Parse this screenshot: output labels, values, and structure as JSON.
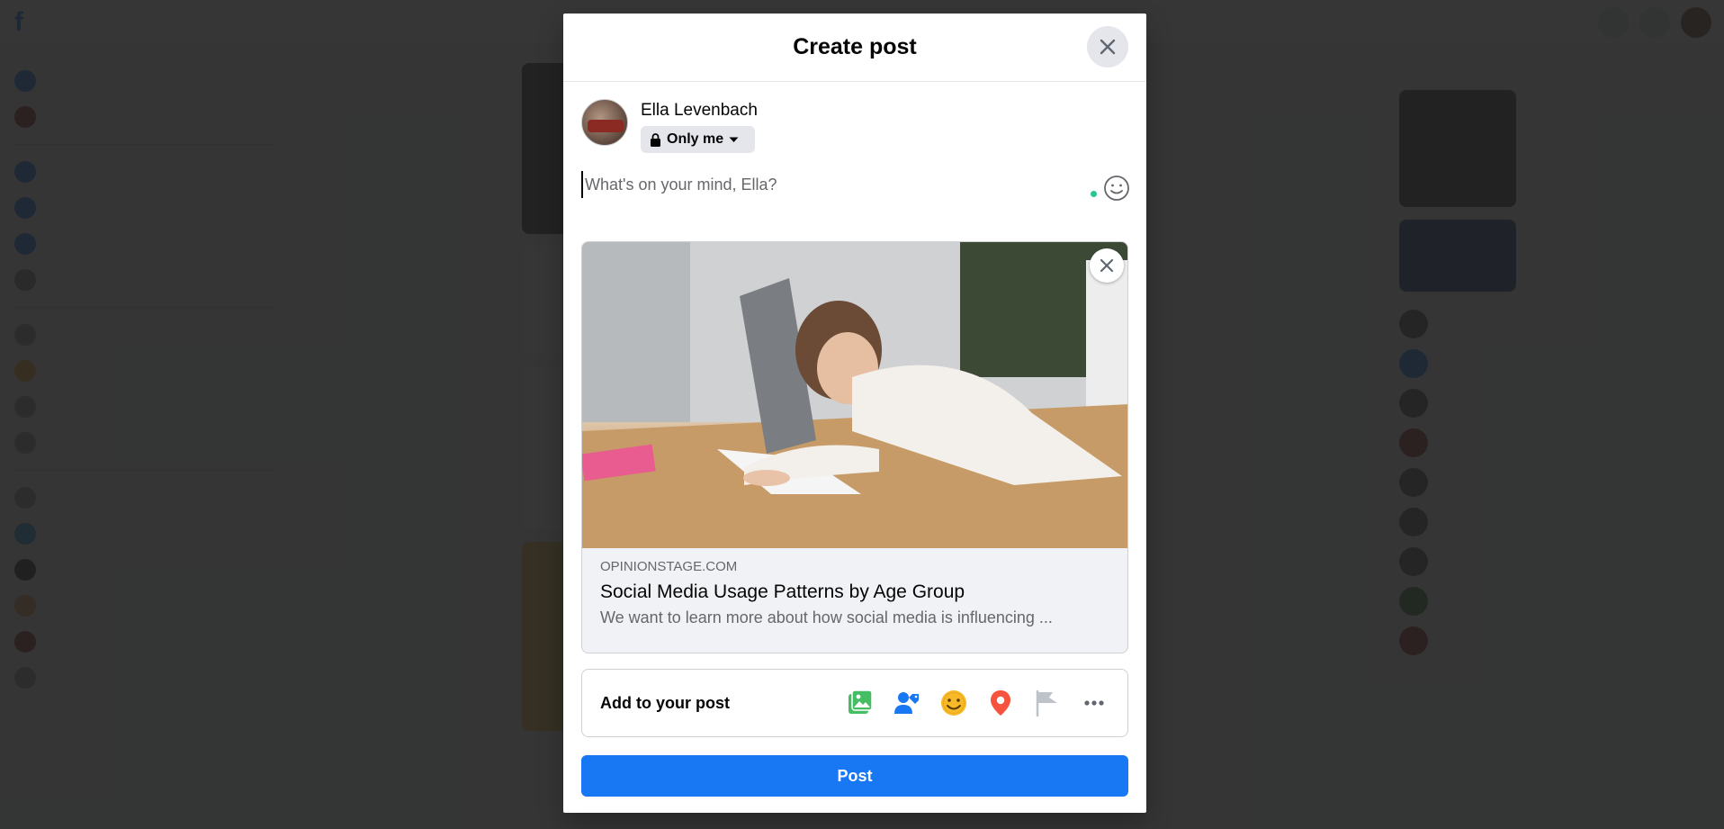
{
  "modal": {
    "title": "Create post",
    "author_name": "Ella Levenbach",
    "audience_label": "Only me",
    "composer_placeholder": "What's on your mind, Ella?",
    "link_preview": {
      "domain": "OPINIONSTAGE.COM",
      "title": "Social Media Usage Patterns by Age Group",
      "description": "We want to learn more about how social media is influencing ..."
    },
    "add_to_post_label": "Add to your post",
    "add_to_post_icons": [
      "photo-video-icon",
      "tag-people-icon",
      "feeling-icon",
      "check-in-icon",
      "life-event-flag-icon",
      "more-icon"
    ],
    "post_button_label": "Post"
  },
  "colors": {
    "accent": "#1877f2",
    "overlay": "#202020",
    "photo_green": "#45bd62",
    "tag_blue": "#1877f2",
    "feeling_yellow": "#f7b928",
    "checkin_red": "#f5533d",
    "flag_gray": "#bec3c9"
  }
}
